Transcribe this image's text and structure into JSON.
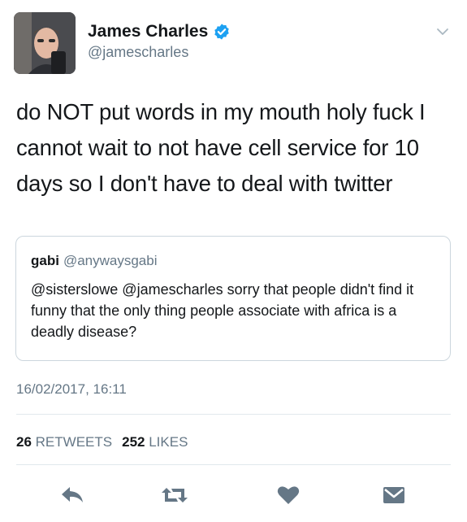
{
  "author": {
    "display_name": "James Charles",
    "handle": "@jamescharles",
    "verified": true
  },
  "tweet": {
    "text": "do NOT put words in my mouth holy fuck I cannot wait to not have cell service for 10 days so I don't have to deal with twitter"
  },
  "quoted_tweet": {
    "name": "gabi",
    "handle": "@anywaysgabi",
    "text": "@sisterslowe @jamescharles sorry that people didn't find it funny that the only thing people associate with africa is a deadly disease?"
  },
  "timestamp": "16/02/2017, 16:11",
  "stats": {
    "retweets_count": "26",
    "retweets_label": "RETWEETS",
    "likes_count": "252",
    "likes_label": "LIKES"
  },
  "icons": {
    "verified": "verified-badge-icon",
    "menu": "chevron-down-icon",
    "reply": "reply-icon",
    "retweet": "retweet-icon",
    "like": "heart-icon",
    "message": "direct-message-icon"
  },
  "colors": {
    "text": "#14171a",
    "secondary": "#657786",
    "verified": "#1da1f2",
    "border": "#ccd6dd"
  }
}
